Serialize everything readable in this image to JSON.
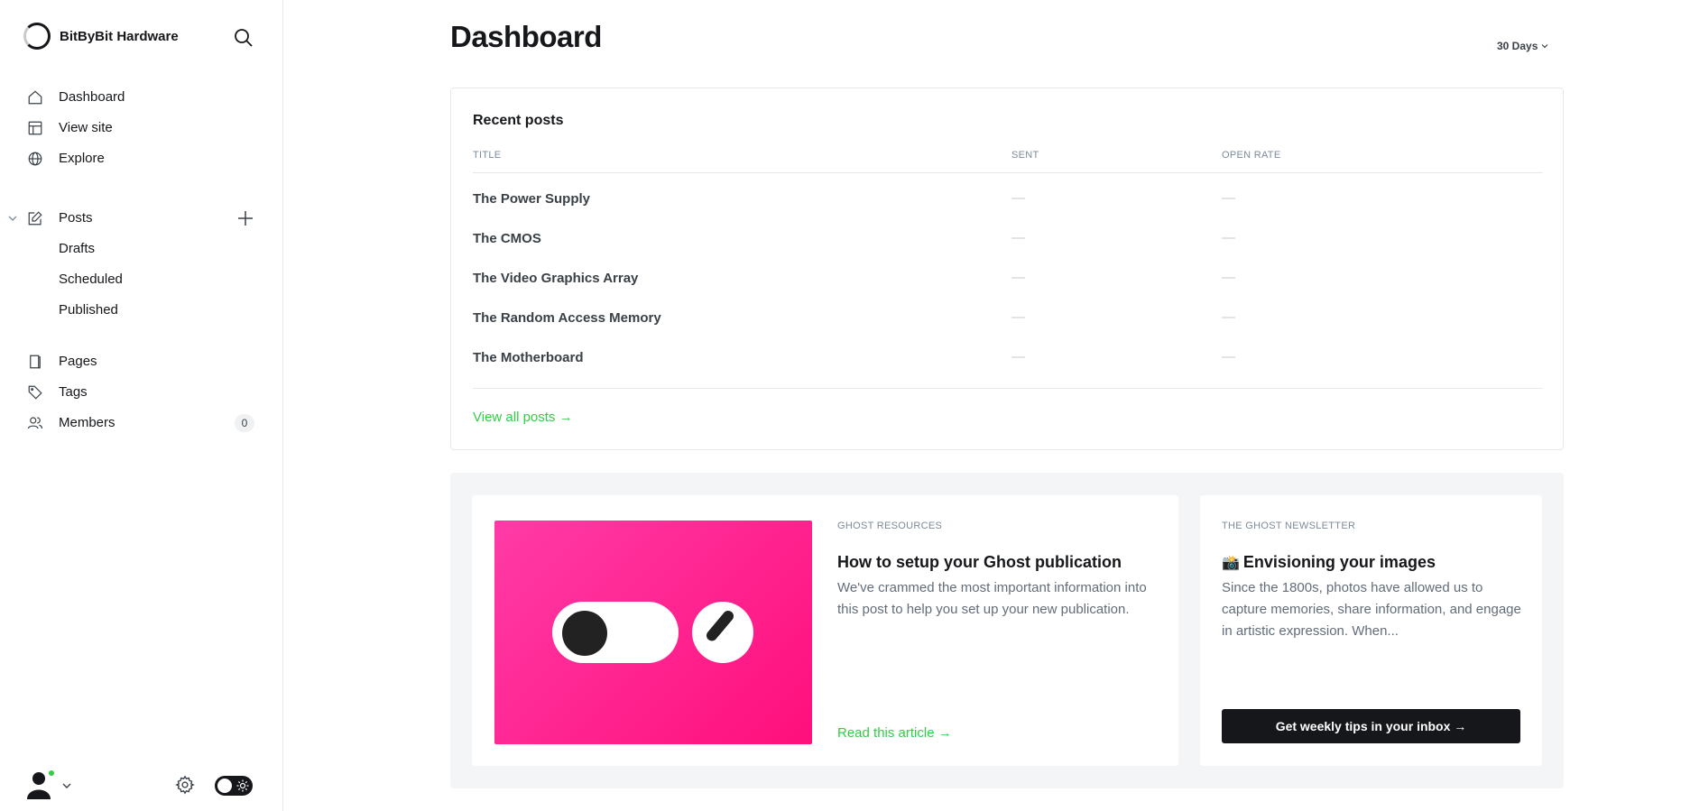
{
  "brand": {
    "name": "BitByBit Hardware"
  },
  "nav": {
    "primary": [
      {
        "label": "Dashboard",
        "icon": "home-icon"
      },
      {
        "label": "View site",
        "icon": "layout-icon"
      },
      {
        "label": "Explore",
        "icon": "globe-icon"
      }
    ],
    "posts": {
      "label": "Posts",
      "icon": "pencil-square-icon"
    },
    "posts_sub": [
      "Drafts",
      "Scheduled",
      "Published"
    ],
    "secondary": [
      {
        "label": "Pages",
        "icon": "book-icon"
      },
      {
        "label": "Tags",
        "icon": "tag-icon"
      },
      {
        "label": "Members",
        "icon": "users-icon"
      }
    ],
    "members_count": "0"
  },
  "header": {
    "title": "Dashboard",
    "range": "30 Days"
  },
  "recent_posts": {
    "title": "Recent posts",
    "columns": [
      "TITLE",
      "SENT",
      "OPEN RATE"
    ],
    "rows": [
      {
        "title": "The Power Supply",
        "sent": "—",
        "open_rate": "—"
      },
      {
        "title": "The CMOS",
        "sent": "—",
        "open_rate": "—"
      },
      {
        "title": "The Video Graphics Array",
        "sent": "—",
        "open_rate": "—"
      },
      {
        "title": "The Random Access Memory",
        "sent": "—",
        "open_rate": "—"
      },
      {
        "title": "The Motherboard",
        "sent": "—",
        "open_rate": "—"
      }
    ],
    "view_all": "View all posts →"
  },
  "resource": {
    "category": "GHOST RESOURCES",
    "title": "How to setup your Ghost publication",
    "description": "We've crammed the most important information into this post to help you set up your new publication.",
    "link": "Read this article →"
  },
  "newsletter": {
    "category": "THE GHOST NEWSLETTER",
    "emoji": "📸",
    "title": "Envisioning your images",
    "description": "Since the 1800s, photos have allowed us to capture memories, share information, and engage in artistic expression. When...",
    "button": "Get weekly tips in your inbox →"
  },
  "colors": {
    "accent": "#30cf43",
    "dark": "#15171a",
    "image_pink": "#ff1f8e"
  }
}
